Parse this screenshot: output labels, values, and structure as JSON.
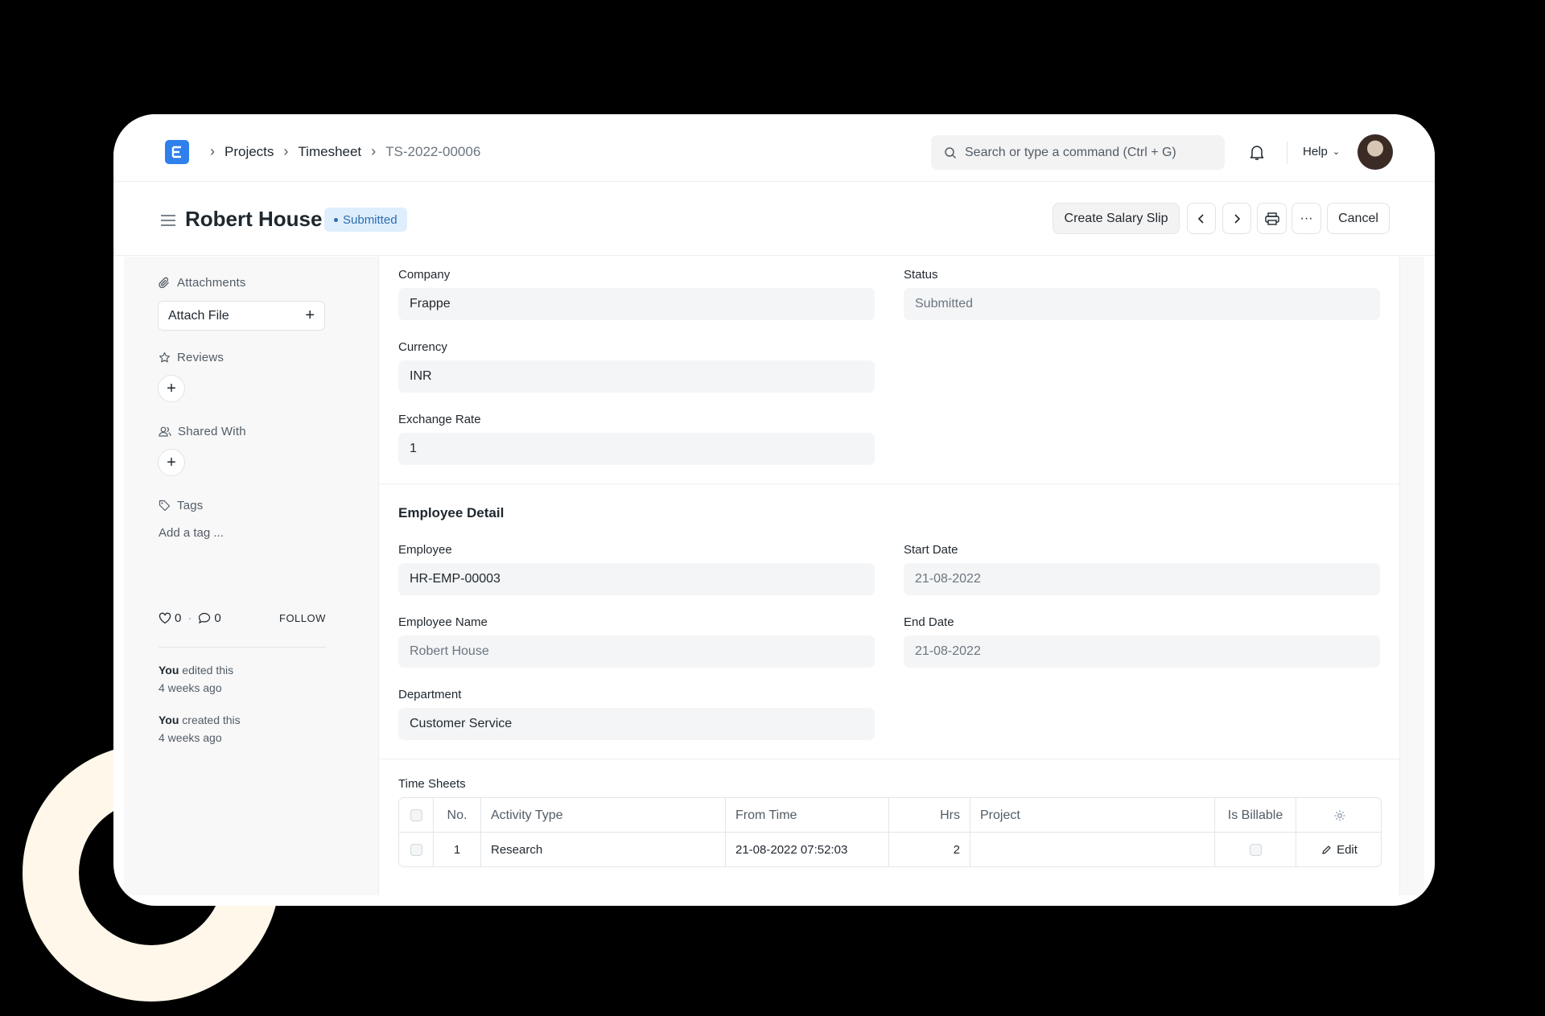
{
  "navbar": {
    "breadcrumbs": [
      "Projects",
      "Timesheet",
      "TS-2022-00006"
    ],
    "search_placeholder": "Search or type a command (Ctrl + G)",
    "help_label": "Help"
  },
  "page": {
    "title": "Robert House",
    "status_badge": "Submitted",
    "actions": {
      "create_salary_slip": "Create Salary Slip",
      "more": "···",
      "cancel": "Cancel"
    }
  },
  "sidebar": {
    "attachments_label": "Attachments",
    "attach_file_label": "Attach File",
    "reviews_label": "Reviews",
    "shared_with_label": "Shared With",
    "tags_label": "Tags",
    "add_tag_label": "Add a tag ...",
    "likes_count": "0",
    "comments_count": "0",
    "follow_label": "FOLLOW",
    "activity": [
      {
        "who": "You",
        "action": "edited this",
        "when": "4 weeks ago"
      },
      {
        "who": "You",
        "action": "created this",
        "when": "4 weeks ago"
      }
    ]
  },
  "form": {
    "company": {
      "label": "Company",
      "value": "Frappe"
    },
    "status": {
      "label": "Status",
      "value": "Submitted"
    },
    "currency": {
      "label": "Currency",
      "value": "INR"
    },
    "exchange_rate": {
      "label": "Exchange Rate",
      "value": "1"
    },
    "employee_detail_title": "Employee Detail",
    "employee": {
      "label": "Employee",
      "value": "HR-EMP-00003"
    },
    "start_date": {
      "label": "Start Date",
      "value": "21-08-2022"
    },
    "employee_name": {
      "label": "Employee Name",
      "value": "Robert House"
    },
    "end_date": {
      "label": "End Date",
      "value": "21-08-2022"
    },
    "department": {
      "label": "Department",
      "value": "Customer Service"
    }
  },
  "time_sheets": {
    "label": "Time Sheets",
    "columns": [
      "No.",
      "Activity Type",
      "From Time",
      "Hrs",
      "Project",
      "Is Billable"
    ],
    "rows": [
      {
        "no": "1",
        "activity_type": "Research",
        "from_time": "21-08-2022 07:52:03",
        "hrs": "2",
        "project": "",
        "edit_label": "Edit"
      }
    ]
  },
  "colors": {
    "accent": "#2f80ed",
    "badge_bg": "#dfeefc",
    "badge_text": "#2b6cb0",
    "ring": "#fff7e9"
  }
}
